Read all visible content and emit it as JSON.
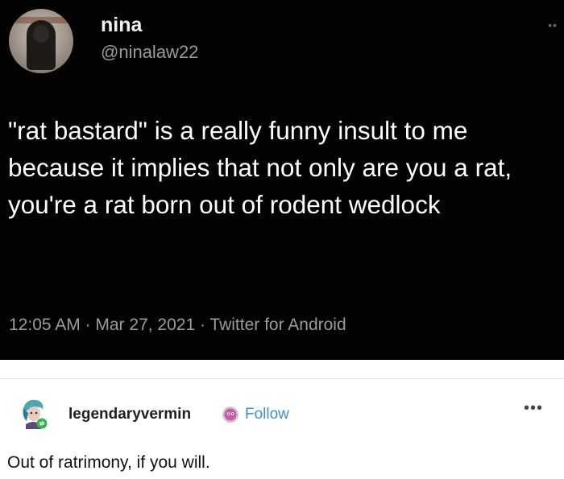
{
  "tweet": {
    "display_name": "nina",
    "handle": "@ninalaw22",
    "more_icon": "ellipsis-icon",
    "text": "\"rat bastard\" is a really funny insult to me because it implies that not only are you a rat, you're a rat born out of rodent wedlock",
    "meta": "12:05 AM · Mar 27, 2021 · Twitter for Android"
  },
  "reply": {
    "author": "legendaryvermin",
    "badge_icon": "pink-badge-icon",
    "follow_label": "Follow",
    "more_icon": "ellipsis-icon",
    "text": "Out of ratrimony, if you will."
  },
  "colors": {
    "tweet_background": "#030303",
    "follow_link": "#3a8fd6",
    "reblog_badge": "#36b34a"
  }
}
